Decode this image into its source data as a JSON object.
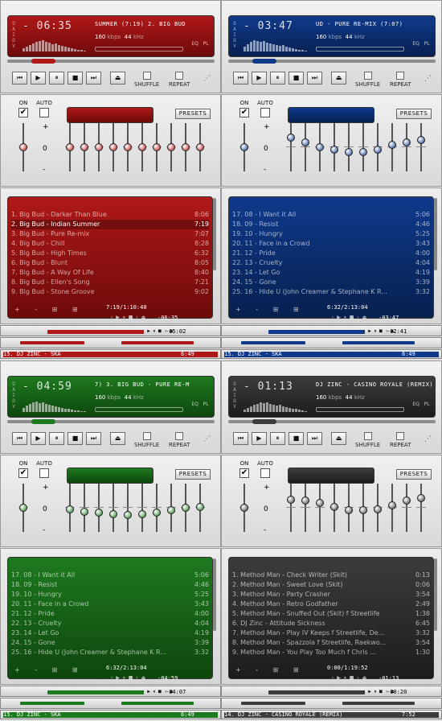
{
  "common": {
    "oaidv": "OAIDV",
    "kbps_label": "kbps",
    "khz_label": "kHz",
    "eq_label": "EQ",
    "pl_label": "PL",
    "shuffle": "SHUFFLE",
    "repeat": "REPEAT",
    "on": "ON",
    "auto": "AUTO",
    "presets": "PRESETS",
    "plus": "+",
    "zero": "0",
    "minus": "-",
    "pl_add": "+ - ⊞ ⊞"
  },
  "skins": [
    {
      "theme": "red",
      "accent": "#b01818",
      "accent_dark": "#6e0a0a",
      "player": {
        "time": "- 06:35",
        "title": "SUMMER (7:19)   2. BIG BUD",
        "kbps": "160",
        "khz": "44"
      },
      "playlist": {
        "items": [
          {
            "title": "1. Big Bud - Darker Than Blue",
            "dur": "8:06"
          },
          {
            "title": "2. Big Bud - Indian Summer",
            "dur": "7:19"
          },
          {
            "title": "3. Big Bud - Pure Re-mix",
            "dur": "7:07"
          },
          {
            "title": "4. Big Bud - Chill",
            "dur": "8:28"
          },
          {
            "title": "5. Big Bud - High Times",
            "dur": "6:32"
          },
          {
            "title": "6. Big Bud - Blunt",
            "dur": "8:05"
          },
          {
            "title": "7. Big Bud - A Way Of Life",
            "dur": "8:40"
          },
          {
            "title": "8. Big Bud - Ellen's Song",
            "dur": "7:21"
          },
          {
            "title": "9. Big Bud - Stone Groove",
            "dur": "9:02"
          }
        ],
        "selected": 1,
        "total": "7:19/1:10:40",
        "remaining": "-06:35"
      },
      "shade": {
        "time": "-05:02"
      },
      "plshade": {
        "text": "15. DJ ZINC - SKA",
        "time": "6:49"
      }
    },
    {
      "theme": "blue",
      "accent": "#0f3a8c",
      "accent_dark": "#07204f",
      "player": {
        "time": "- 03:47",
        "title": "UD - PURE RE-MIX (7:07)",
        "kbps": "160",
        "khz": "44"
      },
      "playlist": {
        "items": [
          {
            "title": "17. 08 - I Want it All",
            "dur": "5:06"
          },
          {
            "title": "18. 09 - Resist",
            "dur": "4:46"
          },
          {
            "title": "19. 10 - Hungry",
            "dur": "5:25"
          },
          {
            "title": "20. 11 - Face in a Crowd",
            "dur": "3:43"
          },
          {
            "title": "21. 12 - Pride",
            "dur": "4:00"
          },
          {
            "title": "22. 13 - Cruelty",
            "dur": "4:04"
          },
          {
            "title": "23. 14 - Let Go",
            "dur": "4:19"
          },
          {
            "title": "24. 15 - Gone",
            "dur": "3:39"
          },
          {
            "title": "25. 16 - Hide U (John Creamer & Stephane K R...",
            "dur": "3:32"
          }
        ],
        "selected": -1,
        "total": "6:32/2:13:04",
        "remaining": "-03:47"
      },
      "shade": {
        "time": "-02:41"
      },
      "plshade": {
        "text": "15. DJ ZINC - SKA",
        "time": "6:49"
      }
    },
    {
      "theme": "green",
      "accent": "#1e7a1e",
      "accent_dark": "#0e460e",
      "player": {
        "time": "- 04:59",
        "title": "7)   3. BIG BUD - PURE RE-M",
        "kbps": "160",
        "khz": "44"
      },
      "playlist": {
        "items": [
          {
            "title": "17. 08 - I Want it All",
            "dur": "5:06"
          },
          {
            "title": "18. 09 - Resist",
            "dur": "4:46"
          },
          {
            "title": "19. 10 - Hungry",
            "dur": "5:25"
          },
          {
            "title": "20. 11 - Face in a Crowd",
            "dur": "3:43"
          },
          {
            "title": "21. 12 - Pride",
            "dur": "4:00"
          },
          {
            "title": "22. 13 - Cruelty",
            "dur": "4:04"
          },
          {
            "title": "23. 14 - Let Go",
            "dur": "4:19"
          },
          {
            "title": "24. 15 - Gone",
            "dur": "3:39"
          },
          {
            "title": "25. 16 - Hide U (John Creamer & Stephane K R...",
            "dur": "3:32"
          }
        ],
        "selected": -1,
        "total": "6:32/2:13:04",
        "remaining": "-04:59"
      },
      "shade": {
        "time": "-04:07"
      },
      "plshade": {
        "text": "15. DJ ZINC - SKA",
        "time": "6:49"
      }
    },
    {
      "theme": "gray",
      "accent": "#3c3c3c",
      "accent_dark": "#1c1c1c",
      "player": {
        "time": "- 01:13",
        "title": "DJ ZINC - CASINO ROYALE (REMIX)",
        "kbps": "160",
        "khz": "44"
      },
      "playlist": {
        "items": [
          {
            "title": "1. Method Man - Check Writer (Skit)",
            "dur": "0:13"
          },
          {
            "title": "2. Method Man - Sweet Love (Skit)",
            "dur": "0:06"
          },
          {
            "title": "3. Method Man - Party Crasher",
            "dur": "3:54"
          },
          {
            "title": "4. Method Man - Retro Godfather",
            "dur": "2:49"
          },
          {
            "title": "5. Method Man - Snuffed Out (Skit) f Streetlife",
            "dur": "1:38"
          },
          {
            "title": "6. DJ Zinc - Attitude Sickness",
            "dur": "6:45"
          },
          {
            "title": "7. Method Man - Play IV Keeps f Streetlife, De...",
            "dur": "3:32"
          },
          {
            "title": "8. Method Man - Spazzola f Streetlife, Raekwo...",
            "dur": "3:54"
          },
          {
            "title": "9. Method Man - You Play Too Much f Chris ...",
            "dur": "1:30"
          }
        ],
        "selected": -1,
        "total": "0:00/1:19:52",
        "remaining": "-01:13"
      },
      "shade": {
        "time": "-00:20"
      },
      "plshade": {
        "text": "14. DJ ZINC - CASINO ROYALE (REMIX)",
        "time": "7:52"
      }
    }
  ]
}
